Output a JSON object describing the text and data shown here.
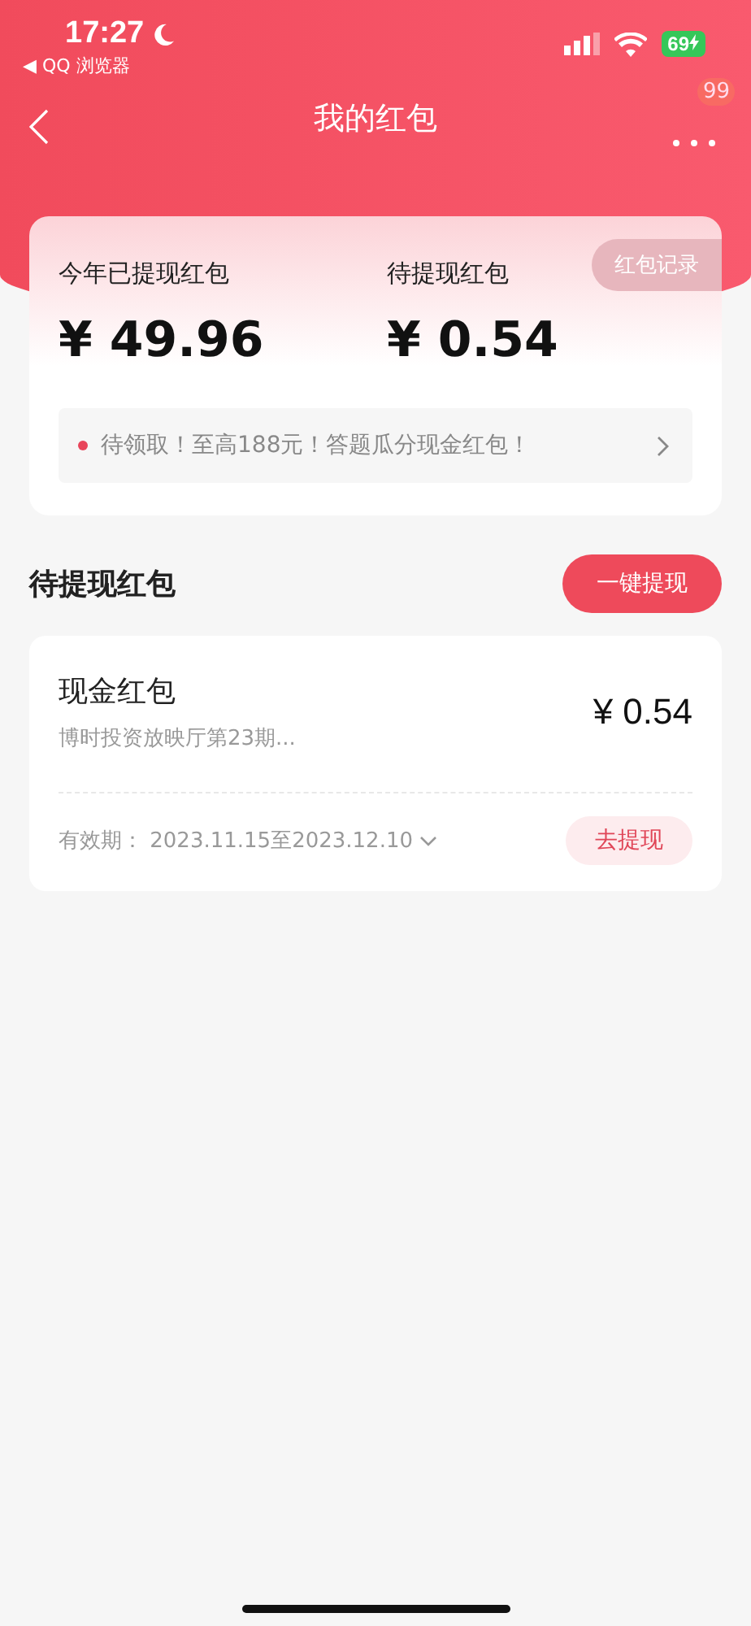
{
  "status_bar": {
    "time": "17:27",
    "back_app": "◀ QQ 浏览器",
    "battery": "69"
  },
  "nav": {
    "title": "我的红包",
    "badge": "99"
  },
  "summary": {
    "record_button": "红包记录",
    "stats": [
      {
        "label": "今年已提现红包",
        "currency": "¥",
        "amount": "49.96"
      },
      {
        "label": "待提现红包",
        "currency": "¥",
        "amount": "0.54"
      }
    ],
    "notice": "待领取！至高188元！答题瓜分现金红包！"
  },
  "pending": {
    "title": "待提现红包",
    "withdraw_all": "一键提现",
    "items": [
      {
        "name": "现金红包",
        "source": "博时投资放映厅第23期...",
        "amount": "¥ 0.54",
        "validity_label": "有效期：",
        "validity": "2023.11.15至2023.12.10",
        "action": "去提现"
      }
    ]
  }
}
